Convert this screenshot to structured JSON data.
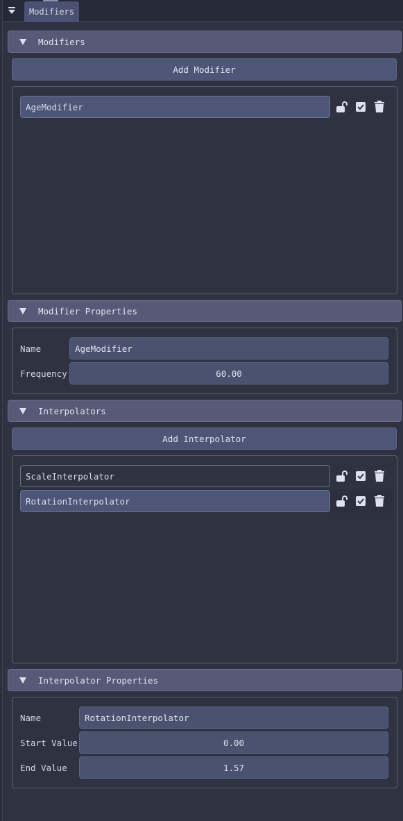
{
  "tab": {
    "label": "Modifiers"
  },
  "modifiers_section": {
    "header": "Modifiers",
    "add_button": "Add Modifier",
    "items": [
      {
        "name": "AgeModifier",
        "selected": true
      }
    ]
  },
  "modifier_properties": {
    "header": "Modifier Properties",
    "name_label": "Name",
    "name_value": "AgeModifier",
    "frequency_label": "Frequency",
    "frequency_value": "60.00"
  },
  "interpolators_section": {
    "header": "Interpolators",
    "add_button": "Add Interpolator",
    "items": [
      {
        "name": "ScaleInterpolator",
        "selected": false
      },
      {
        "name": "RotationInterpolator",
        "selected": true
      }
    ]
  },
  "interpolator_properties": {
    "header": "Interpolator Properties",
    "name_label": "Name",
    "name_value": "RotationInterpolator",
    "start_label": "Start Value",
    "start_value": "0.00",
    "end_label": "End Value",
    "end_value": "1.57"
  },
  "icons": {
    "tab_menu": "triangle-down-icon",
    "section_collapse": "triangle-down-icon",
    "lock": "lock-open-icon",
    "enabled": "checkbox-checked-icon",
    "delete": "trash-icon"
  },
  "colors": {
    "background": "#2f3241",
    "header": "#565a76",
    "button": "#4d5676",
    "field": "#4a5270",
    "text": "#dfe2ee"
  }
}
